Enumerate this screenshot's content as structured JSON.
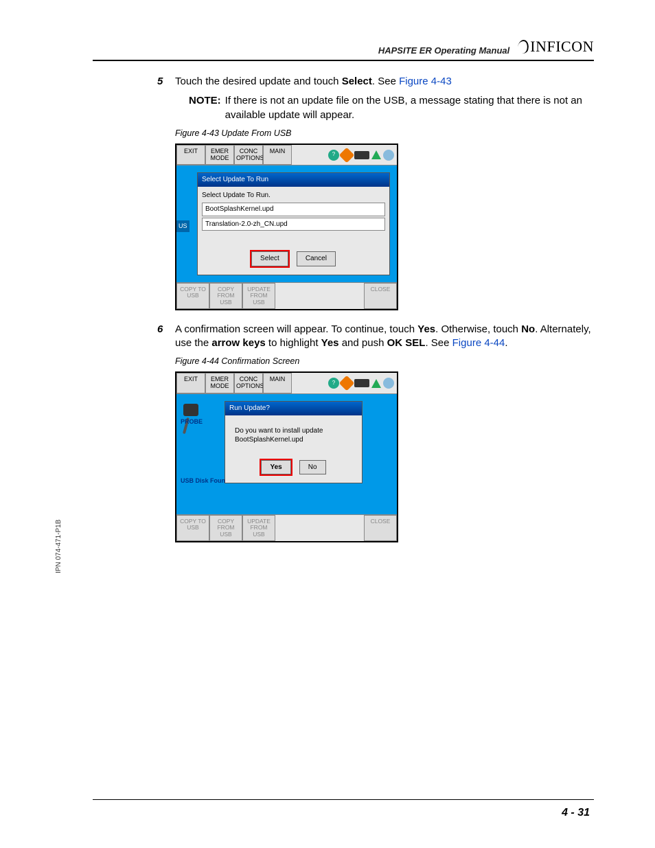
{
  "header": {
    "manual_title": "HAPSITE ER Operating Manual",
    "brand": "INFICON"
  },
  "side_ipn": "IPN 074-471-P1B",
  "page_number": "4 - 31",
  "steps": {
    "s5": {
      "num": "5",
      "text_a": "Touch the desired update and touch ",
      "text_b": "Select",
      "text_c": ". See ",
      "link": "Figure 4-43"
    },
    "note": {
      "label": "NOTE:",
      "text": "If there is not an update file on the USB, a message stating that there is not an available update will appear."
    },
    "s6": {
      "num": "6",
      "text_a": "A confirmation screen will appear. To continue, touch ",
      "yes": "Yes",
      "text_b": ". Otherwise, touch ",
      "no": "No",
      "text_c": ". Alternately, use the ",
      "arrow": "arrow keys",
      "text_d": " to highlight ",
      "yes2": "Yes",
      "text_e": " and push ",
      "oksel": "OK SEL",
      "text_f": ". See ",
      "link": "Figure 4-44",
      "period": "."
    }
  },
  "fig43": {
    "caption": "Figure 4-43  Update From USB",
    "topbar": {
      "exit": "EXIT",
      "emer": "EMER MODE",
      "conc": "CONC OPTIONS",
      "main": "MAIN"
    },
    "side_tab": "US",
    "dialog_title": "Select Update To Run",
    "dialog_label": "Select Update To Run.",
    "files": [
      "BootSplashKernel.upd",
      "Translation-2.0-zh_CN.upd"
    ],
    "select": "Select",
    "cancel": "Cancel",
    "bottom": {
      "copyto": "COPY TO USB",
      "copyfrom": "COPY FROM USB",
      "update": "UPDATE FROM USB",
      "close": "CLOSE"
    }
  },
  "fig44": {
    "caption": "Figure 4-44  Confirmation Screen",
    "topbar": {
      "exit": "EXIT",
      "emer": "EMER MODE",
      "conc": "CONC OPTIONS",
      "main": "MAIN"
    },
    "probe": "PROBE",
    "usb": "USB Disk Foun",
    "dialog_title": "Run Update?",
    "msg1": "Do you want to install update",
    "msg2": "BootSplashKernel.upd",
    "yes": "Yes",
    "no": "No",
    "bottom": {
      "copyto": "COPY TO USB",
      "copyfrom": "COPY FROM USB",
      "update": "UPDATE FROM USB",
      "close": "CLOSE"
    }
  }
}
